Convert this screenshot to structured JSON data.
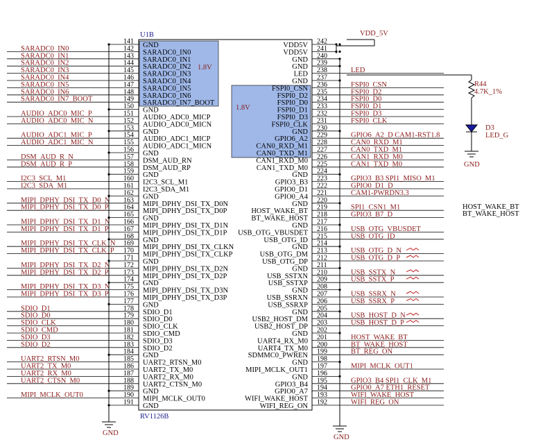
{
  "component": {
    "ref": "U1B",
    "value": "RV1126B",
    "highlight_left_label": "1.8V",
    "highlight_right_label": "1.8V"
  },
  "left_pins": [
    {
      "num": "141",
      "name": "GND",
      "net": ""
    },
    {
      "num": "142",
      "name": "SARADC0_IN0",
      "net": "SARADC0_IN0"
    },
    {
      "num": "143",
      "name": "SARADC0_IN1",
      "net": "SARADC0_IN1"
    },
    {
      "num": "144",
      "name": "SARADC0_IN2",
      "net": "SARADC0_IN2"
    },
    {
      "num": "145",
      "name": "SARADC0_IN3",
      "net": "SARADC0_IN3"
    },
    {
      "num": "146",
      "name": "SARADC0_IN4",
      "net": "SARADC0_IN4"
    },
    {
      "num": "147",
      "name": "SARADC0_IN5",
      "net": "SARADC0_IN5"
    },
    {
      "num": "148",
      "name": "SARADC0_IN6",
      "net": "SARADC0_IN6"
    },
    {
      "num": "149",
      "name": "SARADC0_IN7_BOOT",
      "net": "SARADC0_IN7_BOOT"
    },
    {
      "num": "150",
      "name": "GND",
      "net": ""
    },
    {
      "num": "151",
      "name": "AUDIO_ADC0_MICP",
      "net": "AUDIO_ADC0_MIC_P"
    },
    {
      "num": "152",
      "name": "AUDIO_ADC0_MICN",
      "net": "AUDIO_ADC0_MIC_N"
    },
    {
      "num": "153",
      "name": "GND",
      "net": ""
    },
    {
      "num": "154",
      "name": "AUDIO_ADC1_MICP",
      "net": "AUDIO_ADC1_MIC_P"
    },
    {
      "num": "155",
      "name": "AUDIO_ADC1_MICN",
      "net": "AUDIO_ADC1_MIC_N"
    },
    {
      "num": "156",
      "name": "GND",
      "net": ""
    },
    {
      "num": "157",
      "name": "DSM_AUD_RN",
      "net": "DSM_AUD_R_N"
    },
    {
      "num": "158",
      "name": "DSM_AUD_RP",
      "net": "DSM_AUD_R_P"
    },
    {
      "num": "159",
      "name": "GND",
      "net": ""
    },
    {
      "num": "160",
      "name": "I2C3_SCL_M1",
      "net": "I2C3_SCL_M1"
    },
    {
      "num": "161",
      "name": "I2C3_SDA_M1",
      "net": "I2C3_SDA_M1"
    },
    {
      "num": "162",
      "name": "GND",
      "net": ""
    },
    {
      "num": "163",
      "name": "MIPI_DPHY_DSI_TX_D0N",
      "net": "MIPI_DPHY_DSI_TX_D0_N"
    },
    {
      "num": "164",
      "name": "MIPI_DPHY_DSI_TX_D0P",
      "net": "MIPI_DPHY_DSI_TX_D0_P"
    },
    {
      "num": "165",
      "name": "GND",
      "net": ""
    },
    {
      "num": "166",
      "name": "MIPI_DPHY_DSI_TX_D1N",
      "net": "MIPI_DPHY_DSI_TX_D1_N"
    },
    {
      "num": "167",
      "name": "MIPI_DPHY_DSI_TX_D1P",
      "net": "MIPI_DPHY_DSI_TX_D1_P"
    },
    {
      "num": "168",
      "name": "GND",
      "net": ""
    },
    {
      "num": "169",
      "name": "MIPI_DPHY_DSI_TX_CLKN",
      "net": "MIPI_DPHY_DSI_TX_CLK_N"
    },
    {
      "num": "170",
      "name": "MIPI_DPHY_DSI_TX_CLKP",
      "net": "MIPI_DPHY_DSI_TX_CLK_P"
    },
    {
      "num": "171",
      "name": "GND",
      "net": ""
    },
    {
      "num": "172",
      "name": "MIPI_DPHY_DSI_TX_D2N",
      "net": "MIPI_DPHY_DSI_TX_D2_N"
    },
    {
      "num": "173",
      "name": "MIPI_DPHY_DSI_TX_D2P",
      "net": "MIPI_DPHY_DSI_TX_D2_P"
    },
    {
      "num": "174",
      "name": "GND",
      "net": ""
    },
    {
      "num": "175",
      "name": "MIPI_DPHY_DSI_TX_D3N",
      "net": "MIPI_DPHY_DSI_TX_D3_N"
    },
    {
      "num": "176",
      "name": "MIPI_DPHY_DSI_TX_D3P",
      "net": "MIPI_DPHY_DSI_TX_D3_P"
    },
    {
      "num": "177",
      "name": "GND",
      "net": ""
    },
    {
      "num": "178",
      "name": "SDIO_D1",
      "net": "SDIO_D1"
    },
    {
      "num": "179",
      "name": "SDIO_D0",
      "net": "SDIO_D0"
    },
    {
      "num": "180",
      "name": "SDIO_CLK",
      "net": "SDIO_CLK"
    },
    {
      "num": "181",
      "name": "SDIO_CMD",
      "net": "SDIO_CMD"
    },
    {
      "num": "182",
      "name": "SDIO_D3",
      "net": "SDIO_D3"
    },
    {
      "num": "183",
      "name": "SDIO_D2",
      "net": "SDIO_D2"
    },
    {
      "num": "184",
      "name": "GND",
      "net": ""
    },
    {
      "num": "185",
      "name": "UART2_RTSN_M0",
      "net": "UART2_RTSN_M0"
    },
    {
      "num": "186",
      "name": "UART2_TX_M0",
      "net": "UART2_TX_M0"
    },
    {
      "num": "187",
      "name": "UART2_RX_M0",
      "net": "UART2_RX_M0"
    },
    {
      "num": "188",
      "name": "UART2_CTSN_M0",
      "net": "UART2_CTSN_M0"
    },
    {
      "num": "189",
      "name": "GND",
      "net": ""
    },
    {
      "num": "190",
      "name": "MIPI_MCLK_OUT0",
      "net": "MIPI_MCLK_OUT0"
    },
    {
      "num": "191",
      "name": "GND",
      "net": ""
    }
  ],
  "right_pins": [
    {
      "num": "242",
      "name": "VDD5V",
      "net": ""
    },
    {
      "num": "241",
      "name": "VDD5V",
      "net": ""
    },
    {
      "num": "240",
      "name": "GND",
      "net": ""
    },
    {
      "num": "239",
      "name": "GND",
      "net": ""
    },
    {
      "num": "238",
      "name": "LED",
      "net": "LED"
    },
    {
      "num": "237",
      "name": "GND",
      "net": ""
    },
    {
      "num": "236",
      "name": "FSPI0_CSN",
      "net": "FSPI0_CSN"
    },
    {
      "num": "235",
      "name": "FSPI0_D2",
      "net": "FSPI0_D2"
    },
    {
      "num": "234",
      "name": "FSPI0_D0",
      "net": "FSPI0_D0"
    },
    {
      "num": "233",
      "name": "FSPI0_D1",
      "net": "FSPI0_D1"
    },
    {
      "num": "232",
      "name": "FSPI0_D3",
      "net": "FSPI0_D3"
    },
    {
      "num": "231",
      "name": "FSPI0_CLK",
      "net": "FSPI0_CLK"
    },
    {
      "num": "230",
      "name": "GND",
      "net": ""
    },
    {
      "num": "229",
      "name": "GPIO6_A2",
      "net": "GPIO6_A2_D    CAM1-RST1.8"
    },
    {
      "num": "228",
      "name": "CAN0_RXD_M1",
      "net": "CAN0_RXD_M1"
    },
    {
      "num": "227",
      "name": "CAN0_TXD_M1",
      "net": "CAN0_TXD_M1"
    },
    {
      "num": "226",
      "name": "CAN1_RXD_M0",
      "net": "CAN1_RXD_M0"
    },
    {
      "num": "225",
      "name": "CAN1_TXD_M0",
      "net": "CAN1_TXD_M0"
    },
    {
      "num": "224",
      "name": "GND",
      "net": ""
    },
    {
      "num": "223",
      "name": "GPIO3_B3",
      "net": "GPIO3_B3    SPI1_MISO_M1"
    },
    {
      "num": "222",
      "name": "GPIO0_D1",
      "net": "GPIO0_D1_D"
    },
    {
      "num": "221",
      "name": "GPIO0_A4",
      "net": "CAM1-PWRDN3.3"
    },
    {
      "num": "220",
      "name": "GND",
      "net": ""
    },
    {
      "num": "219",
      "name": "HOST_WAKE_BT",
      "net": "SPI1_CSN1_M1"
    },
    {
      "num": "218",
      "name": "BT_WAKE_HOST",
      "net": "GPIO3_B7_D"
    },
    {
      "num": "217",
      "name": "GND",
      "net": ""
    },
    {
      "num": "216",
      "name": "USB_OTG_VBUSDET",
      "net": "USB_OTG_VBUSDET"
    },
    {
      "num": "215",
      "name": "USB_OTG_ID",
      "net": "USB_OTG_ID"
    },
    {
      "num": "214",
      "name": "GND",
      "net": ""
    },
    {
      "num": "213",
      "name": "USB_OTG_DM",
      "net": "USB_OTG_D_N"
    },
    {
      "num": "212",
      "name": "USB_OTG_DP",
      "net": "USB_OTG_D_P"
    },
    {
      "num": "211",
      "name": "GND",
      "net": ""
    },
    {
      "num": "210",
      "name": "USB_SSTXN",
      "net": "USB_SSTX_N"
    },
    {
      "num": "209",
      "name": "USB_SSTXP",
      "net": "USB_SSTX_P"
    },
    {
      "num": "208",
      "name": "GND",
      "net": ""
    },
    {
      "num": "207",
      "name": "USB_SSRXN",
      "net": "USB_SSRX_N"
    },
    {
      "num": "206",
      "name": "USB_SSRXP",
      "net": "USB_SSRX_P"
    },
    {
      "num": "205",
      "name": "GND",
      "net": ""
    },
    {
      "num": "204",
      "name": "USB2_HOST_DM",
      "net": "USB_HOST_D_N"
    },
    {
      "num": "203",
      "name": "USB2_HOST_DP",
      "net": "USB_HOST_D_P"
    },
    {
      "num": "202",
      "name": "GND",
      "net": ""
    },
    {
      "num": "201",
      "name": "UART4_RX_M0",
      "net": "HOST_WAKE_BT"
    },
    {
      "num": "200",
      "name": "UART4_TX_M0",
      "net": "BT_WAKE_HOST"
    },
    {
      "num": "199",
      "name": "SDMMC0_PWREN",
      "net": "BT_REG_ON"
    },
    {
      "num": "198",
      "name": "GND",
      "net": ""
    },
    {
      "num": "197",
      "name": "MIPI_MCLK_OUT1",
      "net": "MIPI_MCLK_OUT1"
    },
    {
      "num": "196",
      "name": "GND",
      "net": ""
    },
    {
      "num": "195",
      "name": "GPIO3_B4",
      "net": "GPIO3_B4    SPI1_CLK_M1"
    },
    {
      "num": "194",
      "name": "GPIO0_A7",
      "net": "GPIO0_A7    ETH1_RESET"
    },
    {
      "num": "193",
      "name": "WIFI_WAKE_HOST",
      "net": "WIFI_WAKE_HOST"
    },
    {
      "num": "192",
      "name": "WIFI_REG_ON",
      "net": "WIFI_REG_ON"
    }
  ],
  "power": {
    "vdd_label": "VDD_5V",
    "gnd_label": "GND",
    "gnd_label_2": "GND",
    "gnd_label_3": "GND"
  },
  "resistor": {
    "ref": "R44",
    "value": "4.7K_1%"
  },
  "diode": {
    "ref": "D3",
    "value": "LED_G"
  },
  "side_notes": [
    "HOST_WAKE_BT",
    "BT_WAKE_HOST"
  ],
  "colors": {
    "net": "#8b1a1a",
    "highlight": "#9fb8e8",
    "line": "#8b2020"
  }
}
